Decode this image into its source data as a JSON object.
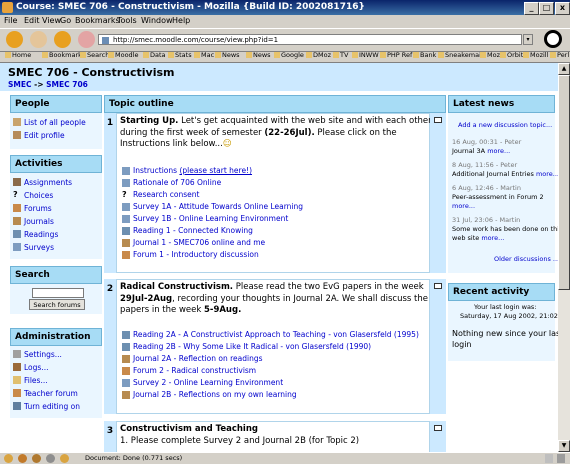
{
  "window": {
    "title": "Course: SMEC 706 - Constructivism - Mozilla {Build ID: 2002081716}",
    "controls": {
      "min": "_",
      "max": "□",
      "close": "x"
    }
  },
  "menu": [
    "File",
    "Edit",
    "View",
    "Go",
    "Bookmarks",
    "Tools",
    "Window",
    "Help"
  ],
  "nav": {
    "url": "http://smec.moodle.com/course/view.php?id=1",
    "go_label": "▾"
  },
  "bookmarks": [
    "Home",
    "Bookmarks",
    "Search",
    "Moodle",
    "Data",
    "Stats",
    "Mac",
    "News",
    "News",
    "Google",
    "DMoz",
    "TV",
    "INWW",
    "PHP Ref",
    "Bank",
    "Sneakemail",
    "Moz",
    "Orbit",
    "Mozill",
    "Perl"
  ],
  "course": {
    "title": "SMEC 706 - Constructivism",
    "breadcrumb": {
      "root": "SMEC",
      "separator": " -> ",
      "current": "SMEC 706"
    }
  },
  "people": {
    "heading": "People",
    "items": [
      "List of all people",
      "Edit profile"
    ]
  },
  "activities": {
    "heading": "Activities",
    "items": [
      "Assignments",
      "Choices",
      "Forums",
      "Journals",
      "Readings",
      "Surveys"
    ]
  },
  "search": {
    "heading": "Search",
    "input_value": "",
    "button": "Search forums"
  },
  "admin": {
    "heading": "Administration",
    "items": [
      "Settings...",
      "Logs...",
      "Files...",
      "Teacher forum",
      "Turn editing on"
    ]
  },
  "outline": {
    "heading": "Topic outline",
    "sections": [
      {
        "num": "1",
        "intro": [
          {
            "bold": "Starting Up.",
            "rest": " Let's get acquainted with the web site and with each other"
          },
          {
            "text": "during the first week of semester "
          },
          {
            "text": "Instructions link below..."
          }
        ],
        "intro_bold_date": "(22-26Jul).",
        "intro_after_date": " Please click on the",
        "intro_smiley": "☺",
        "activities": [
          {
            "label": "Instructions ",
            "link": "(please start here!)"
          },
          {
            "label": "Rationale of 706 Online"
          },
          {
            "label": "Research consent"
          },
          {
            "label": "Survey 1A - Attitude Towards Online Learning"
          },
          {
            "label": "Survey 1B - Online Learning Environment"
          },
          {
            "label": "Reading 1 - Connected Knowing"
          },
          {
            "label": "Journal 1 - SMEC706 online and me"
          },
          {
            "label": "Forum 1 - Introductory discussion"
          }
        ]
      },
      {
        "num": "2",
        "intro": [
          {
            "bold": "Radical Constructivism.",
            "rest": " Please read the two EvG papers in the week"
          },
          {
            "bold": "29Jul-2Aug",
            "rest": ", recording your thoughts in Journal 2A. We shall discuss the"
          },
          {
            "text": "papers in the week ",
            "bold": "5-9Aug."
          }
        ],
        "activities": [
          {
            "label": "Reading 2A - A Constructivist Approach to Teaching - von Glasersfeld (1995)"
          },
          {
            "label": "Reading 2B - Why Some Like It Radical - von Glasersfeld (1990)"
          },
          {
            "label": "Journal 2A - Reflection on readings"
          },
          {
            "label": "Forum 2 - Radical constructivism"
          },
          {
            "label": "Survey 2 - Online Learning Environment"
          },
          {
            "label": "Journal 2B - Reflections on my own learning"
          }
        ]
      },
      {
        "num": "3",
        "intro": [
          {
            "bold": "Constructivism and Teaching"
          },
          {
            "text": "1. Please complete Survey 2 and Journal 2B (for Topic 2)"
          }
        ]
      }
    ]
  },
  "news": {
    "heading": "Latest news",
    "add_link": "Add a new discussion topic...",
    "items": [
      {
        "date": "16 Aug, 00:31 - Peter",
        "text": "Journal 3A ",
        "more": "more..."
      },
      {
        "date": "8 Aug, 11:56 - Peter",
        "text": "Additional Journal Entries ",
        "more": "more..."
      },
      {
        "date": "6 Aug, 12:46 - Martin",
        "text": "Peer-assessment in Forum 2",
        "more": "more..."
      },
      {
        "date": "31 Jul, 23:06 - Martin",
        "text": "Some work has been done on this",
        "text2": "web site ",
        "more": "more..."
      }
    ],
    "older": "Older discussions ..."
  },
  "recent": {
    "heading": "Recent activity",
    "login_label": "Your last login was:",
    "login_date": "Saturday, 17 Aug 2002, 21:02",
    "nothing": [
      "Nothing new since your last",
      "login"
    ]
  },
  "status": {
    "text": "Document: Done (0.771 secs)"
  }
}
